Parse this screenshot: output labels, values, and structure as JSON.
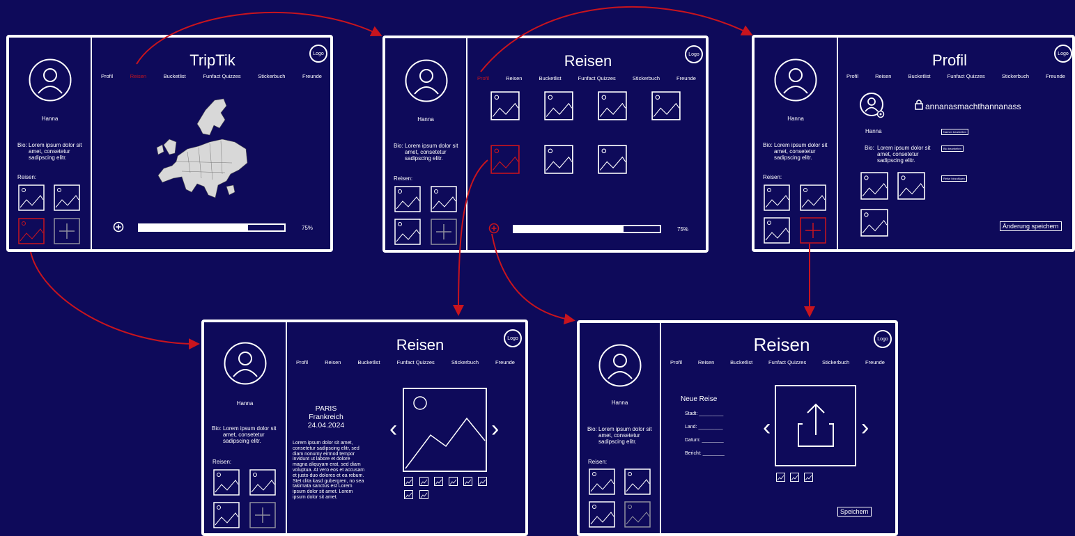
{
  "nav": [
    "Profil",
    "Reisen",
    "Bucketlist",
    "Funfact Quizzes",
    "Stickerbuch",
    "Freunde"
  ],
  "logo": "Logo",
  "user": "Hanna",
  "bio_label": "Bio:",
  "bio_text": "Lorem ipsum dolor sit amet, consetetur sadipscing elitr.",
  "reisen_label": "Reisen:",
  "progress": {
    "value": 0.75,
    "text": "75%"
  },
  "screen1": {
    "title": "TripTik"
  },
  "screen2": {
    "title": "Reisen"
  },
  "screen3": {
    "title": "Profil",
    "username": "annanasmachthannanass",
    "name": "Hanna",
    "bio_label": "Bio:",
    "btn_name": "Namen bearbeiten",
    "btn_bio": "Bio bearbeiten",
    "btn_reise": "Reise hinzufügen",
    "btn_save": "Änderung speichern"
  },
  "screen4": {
    "title": "Reisen",
    "city": "PARIS",
    "country": "Frankreich",
    "date": "24.04.2024",
    "text": "Lorem ipsum dolor sit amet, consetetur sadipscing elitr, sed diam nonumy eirmod tempor invidunt ut labore et dolore magna aliquyam erat, sed diam voluptua. At vero eos et accusam et justo duo dolores et ea rebum. Stet clita kasd gubergren, no sea takimata sanctus est Lorem ipsum dolor sit amet. Lorem ipsum dolor sit amet.",
    "prev": "‹",
    "next": "›"
  },
  "screen5": {
    "title": "Reisen",
    "heading": "Neue Reise",
    "fields": [
      "Stadt: _________",
      "Land: _________",
      "Datum: ________",
      "Bericht: ________"
    ],
    "save": "Speichern",
    "prev": "‹",
    "next": "›"
  },
  "colors": {
    "background": "#0e0a5a",
    "highlight": "#c8141e",
    "stroke": "#ffffff"
  }
}
